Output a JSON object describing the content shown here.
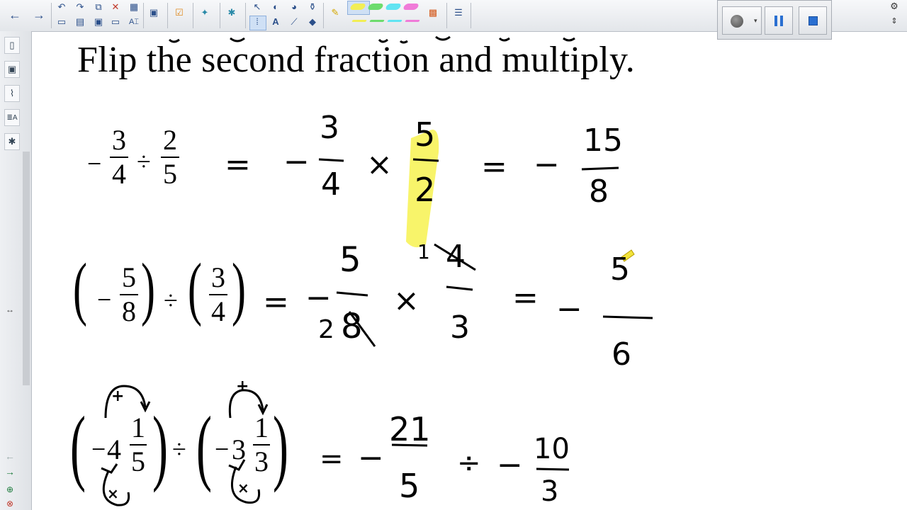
{
  "toolbar": {
    "icons": [
      "back-arrow",
      "forward-arrow",
      "undo",
      "redo",
      "new-page",
      "delete",
      "table",
      "screen-shade",
      "measurement",
      "properties",
      "capture",
      "select",
      "shapes",
      "fill",
      "eraser",
      "pen",
      "highlighter",
      "text",
      "line",
      "color-palette",
      "page-sorter"
    ]
  },
  "recorder": {
    "record_icon": "record-circle",
    "pause_icon": "pause-bars",
    "stop_icon": "stop-square",
    "accent": "#2a6fd1"
  },
  "colors": {
    "highlight": "#f7f35a",
    "pen_green": "#6ddc6d",
    "pen_cyan": "#61e4f2",
    "pen_pink": "#f07bd8",
    "pen_yellow": "#f2ee55"
  },
  "canvas": {
    "instruction": "Flip the second fraction and multiply.",
    "row1": {
      "f1": {
        "sign": "−",
        "n": "3",
        "d": "4"
      },
      "op": "÷",
      "f2": {
        "n": "2",
        "d": "5"
      },
      "eq": "=",
      "h1": {
        "sign": "−",
        "n": "3",
        "d": "4"
      },
      "times": "×",
      "h2": {
        "n": "5",
        "d": "2"
      },
      "eq2": "=",
      "h3": {
        "sign": "−",
        "n": "15",
        "d": "8"
      }
    },
    "row2": {
      "f1": {
        "sign": "−",
        "n": "5",
        "d": "8"
      },
      "op": "÷",
      "f2": {
        "n": "3",
        "d": "4"
      },
      "eq": "=",
      "h1": {
        "sign": "−",
        "n": "5",
        "d": "8",
        "reduced_d": "2"
      },
      "times": "×",
      "h2": {
        "n": "4",
        "reduced_n": "1",
        "d": "3"
      },
      "eq2": "=",
      "h3": {
        "sign": "−",
        "n": "5",
        "d": "6"
      }
    },
    "row3": {
      "m1": {
        "sign": "−",
        "whole": "4",
        "n": "1",
        "d": "5",
        "plus": "+",
        "times": "×"
      },
      "op": "÷",
      "m2": {
        "sign": "−",
        "whole": "3",
        "n": "1",
        "d": "3",
        "plus": "+",
        "times": "×"
      },
      "eq": "=",
      "h1": {
        "sign": "−",
        "n": "21",
        "d": "5"
      },
      "div": "÷",
      "h2": {
        "sign": "−",
        "n": "10",
        "d": "3"
      }
    }
  },
  "sidebar": {
    "tabs": [
      "page-sorter-icon",
      "gallery-icon",
      "attachments-icon",
      "properties-icon",
      "addons-icon"
    ],
    "bottom_icons": [
      "arrow-left-icon",
      "arrow-right-icon",
      "add-page-icon",
      "delete-page-icon"
    ]
  }
}
